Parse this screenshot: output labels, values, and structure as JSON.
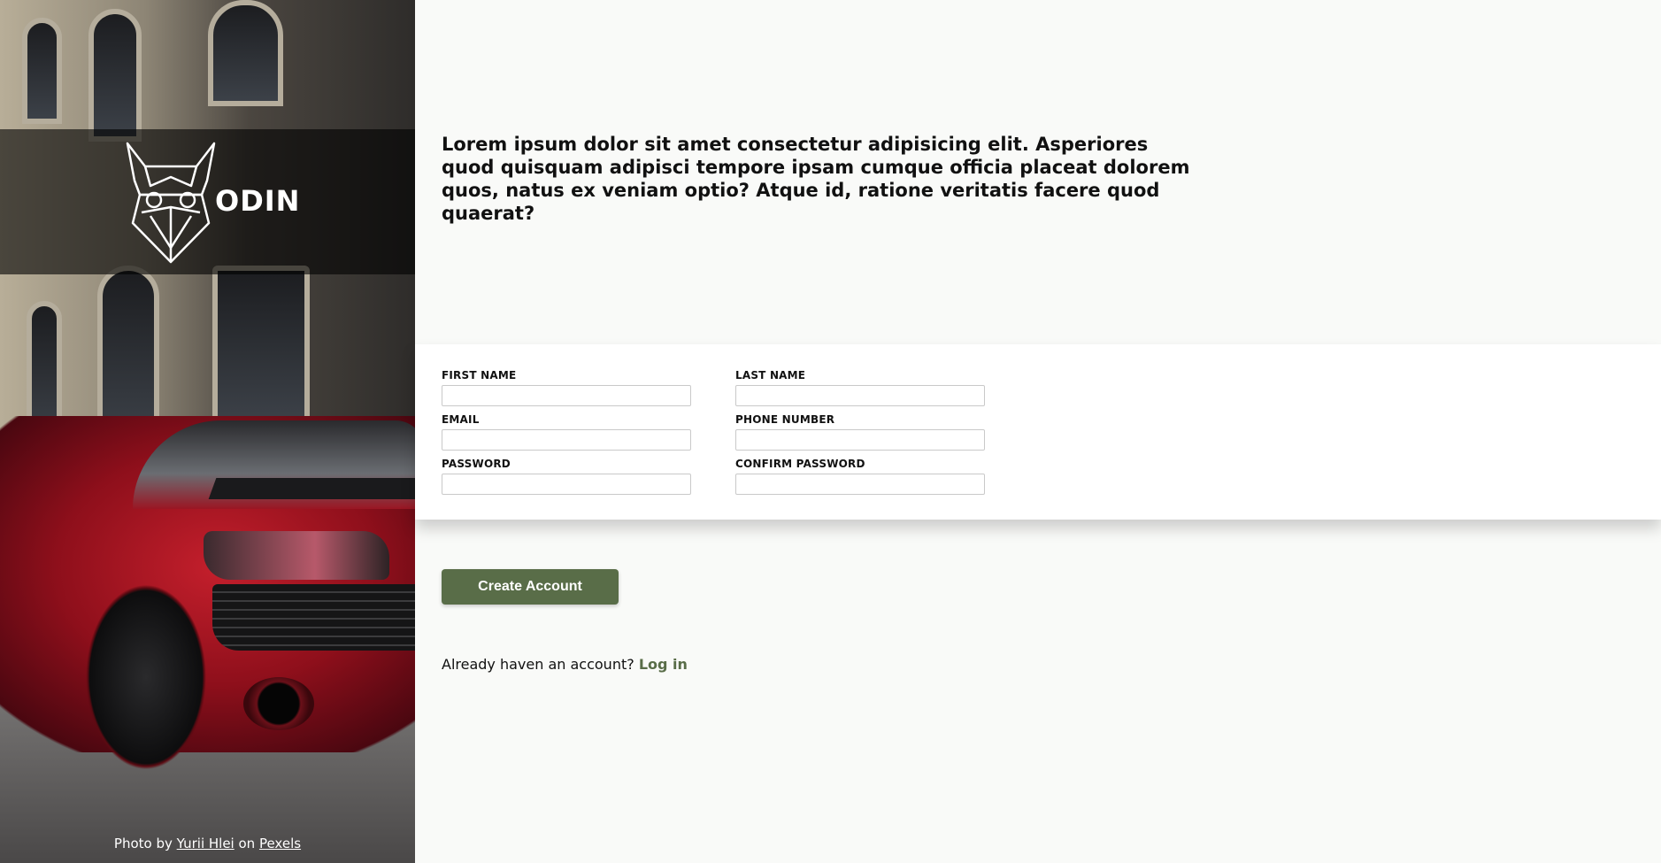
{
  "sidebar": {
    "brand": "ODIN",
    "logo_icon": "viking-helmet-icon",
    "credit": {
      "prefix": "Photo by ",
      "author": "Yurii Hlei",
      "middle": " on ",
      "source": "Pexels"
    }
  },
  "main": {
    "intro": "Lorem ipsum dolor sit amet consectetur adipisicing elit. Asperiores quod quisquam adipisci tempore ipsam cumque officia placeat dolorem quos, natus ex veniam optio? Atque id, ratione veritatis facere quod quaerat?",
    "form": {
      "first_name_label": "FIRST NAME",
      "last_name_label": "LAST NAME",
      "email_label": "EMAIL",
      "phone_label": "PHONE NUMBER",
      "password_label": "PASSWORD",
      "confirm_password_label": "CONFIRM PASSWORD",
      "first_name_value": "",
      "last_name_value": "",
      "email_value": "",
      "phone_value": "",
      "password_value": "",
      "confirm_password_value": ""
    },
    "submit_label": "Create Account",
    "login_prompt": "Already haven an account?",
    "login_link": "Log in"
  },
  "colors": {
    "accent": "#596d48",
    "background": "#f9faf8",
    "panel": "#ffffff"
  }
}
